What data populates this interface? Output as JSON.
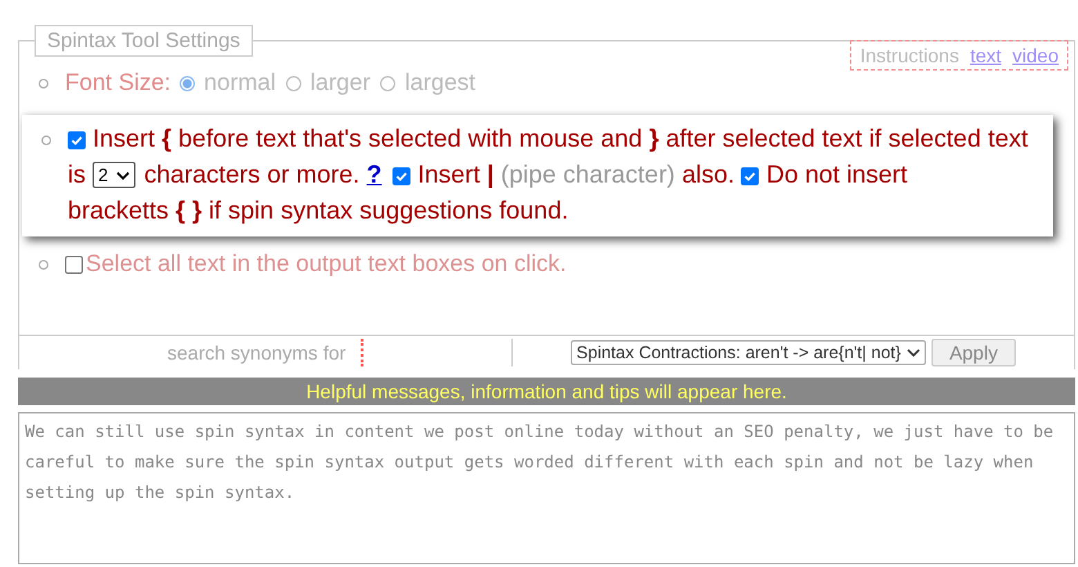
{
  "legend": "Spintax Tool Settings",
  "font_size": {
    "label": "Font Size:",
    "options": [
      {
        "label": "normal",
        "selected": true
      },
      {
        "label": "larger",
        "selected": false
      },
      {
        "label": "largest",
        "selected": false
      }
    ]
  },
  "instructions": {
    "label": "Instructions",
    "links": [
      "text",
      "video"
    ]
  },
  "insert_setting": {
    "segments": [
      {
        "kind": "checkbox",
        "checked": true
      },
      {
        "kind": "text",
        "text": "Insert **{** before text that's selected with mouse and **}** after selected text if selected text"
      },
      {
        "kind": "text",
        "text": "is"
      },
      {
        "kind": "select",
        "value": "2"
      },
      {
        "kind": "text",
        "text": "characters or more."
      },
      {
        "kind": "link",
        "text": "?"
      },
      {
        "kind": "checkbox",
        "checked": true
      },
      {
        "kind": "text",
        "text": "Insert  **|**"
      },
      {
        "kind": "muted",
        "text": "(pipe character)"
      },
      {
        "kind": "text",
        "text": "also."
      },
      {
        "kind": "checkbox",
        "checked": true
      },
      {
        "kind": "text",
        "text": "Do not insert"
      },
      {
        "kind": "text",
        "text": "bracketts **{ }** if spin syntax suggestions found."
      }
    ]
  },
  "select_all": {
    "label": "Select all text in the output text boxes on click.",
    "checked": false
  },
  "search": {
    "placeholder": "search synonyms for"
  },
  "contractions": {
    "value": "Spintax Contractions: aren't -> are{n't| not}",
    "button": "Apply"
  },
  "message": "Helpful messages, information and tips will appear here.",
  "output": {
    "value": "We can still use spin syntax in content we post online today without an SEO penalty, we just have to be careful to make sure the spin syntax output gets worded different with each spin and not be lazy when setting up the spin syntax."
  }
}
